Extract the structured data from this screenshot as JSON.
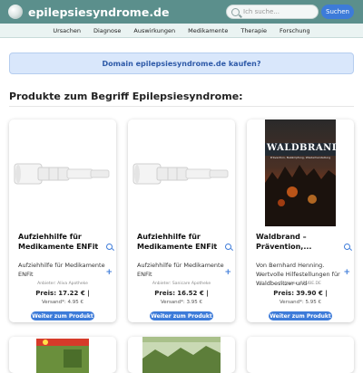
{
  "header": {
    "site_name": "epilepsiesyndrome.de",
    "search_placeholder": "Ich suche...",
    "search_button": "Suchen"
  },
  "nav": {
    "items": [
      "Ursachen",
      "Diagnose",
      "Auswirkungen",
      "Medikamente",
      "Therapie",
      "Forschung"
    ]
  },
  "banner": {
    "text": "Domain epilepsiesyndrome.de kaufen?"
  },
  "section": {
    "title": "Produkte zum Begriff Epilepsiesyndrome:"
  },
  "products": [
    {
      "title": "Aufziehhilfe für Medikamente ENFit",
      "description": "Aufziehhilfe für Medikamente ENFit",
      "seller": "Anbieter: Aliva Apotheke",
      "price_label": "Preis:",
      "price": "17.22 € |",
      "shipping": "Versand*: 4.95 €",
      "button": "Weiter zum Produkt"
    },
    {
      "title": "Aufziehhilfe für Medikamente ENFit",
      "description": "Aufziehhilfe für Medikamente ENFit",
      "seller": "Anbieter: Sanicare Apotheke",
      "price_label": "Preis:",
      "price": "16.52 € |",
      "shipping": "Versand*: 3.95 €",
      "button": "Weiter zum Produkt"
    },
    {
      "title": "Waldbrand – Prävention,...",
      "description": "Von Bernhard Henning. Wertvolle Hilfestellungen für Waldbesitzer und",
      "seller": "Anbieter: GRUBE.DE",
      "price_label": "Preis:",
      "price": "39.90 € |",
      "shipping": "Versand*: 5.95 €",
      "button": "Weiter zum Produkt",
      "cover_title": "WALDBRAND",
      "cover_subtitle": "Prävention, Bekämpfung, Wiederherstellung"
    }
  ]
}
